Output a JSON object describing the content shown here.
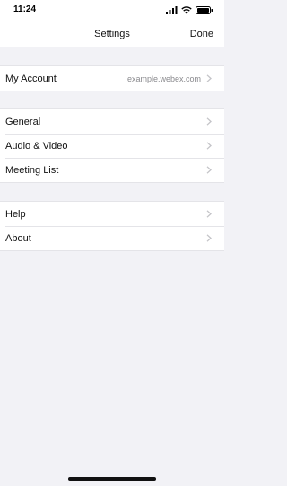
{
  "status_bar": {
    "time": "11:24",
    "icons": [
      "cellular-signal-icon",
      "wifi-icon",
      "battery-icon"
    ]
  },
  "header": {
    "title": "Settings",
    "done_label": "Done"
  },
  "groups": [
    {
      "items": [
        {
          "label": "My Account",
          "value": "example.webex.com"
        }
      ]
    },
    {
      "items": [
        {
          "label": "General"
        },
        {
          "label": "Audio & Video"
        },
        {
          "label": "Meeting List"
        }
      ]
    },
    {
      "items": [
        {
          "label": "Help"
        },
        {
          "label": "About"
        }
      ]
    }
  ],
  "colors": {
    "background": "#f2f2f6",
    "cell": "#ffffff",
    "secondary_text": "#8a8a8e",
    "chevron": "#c4c4c8"
  }
}
